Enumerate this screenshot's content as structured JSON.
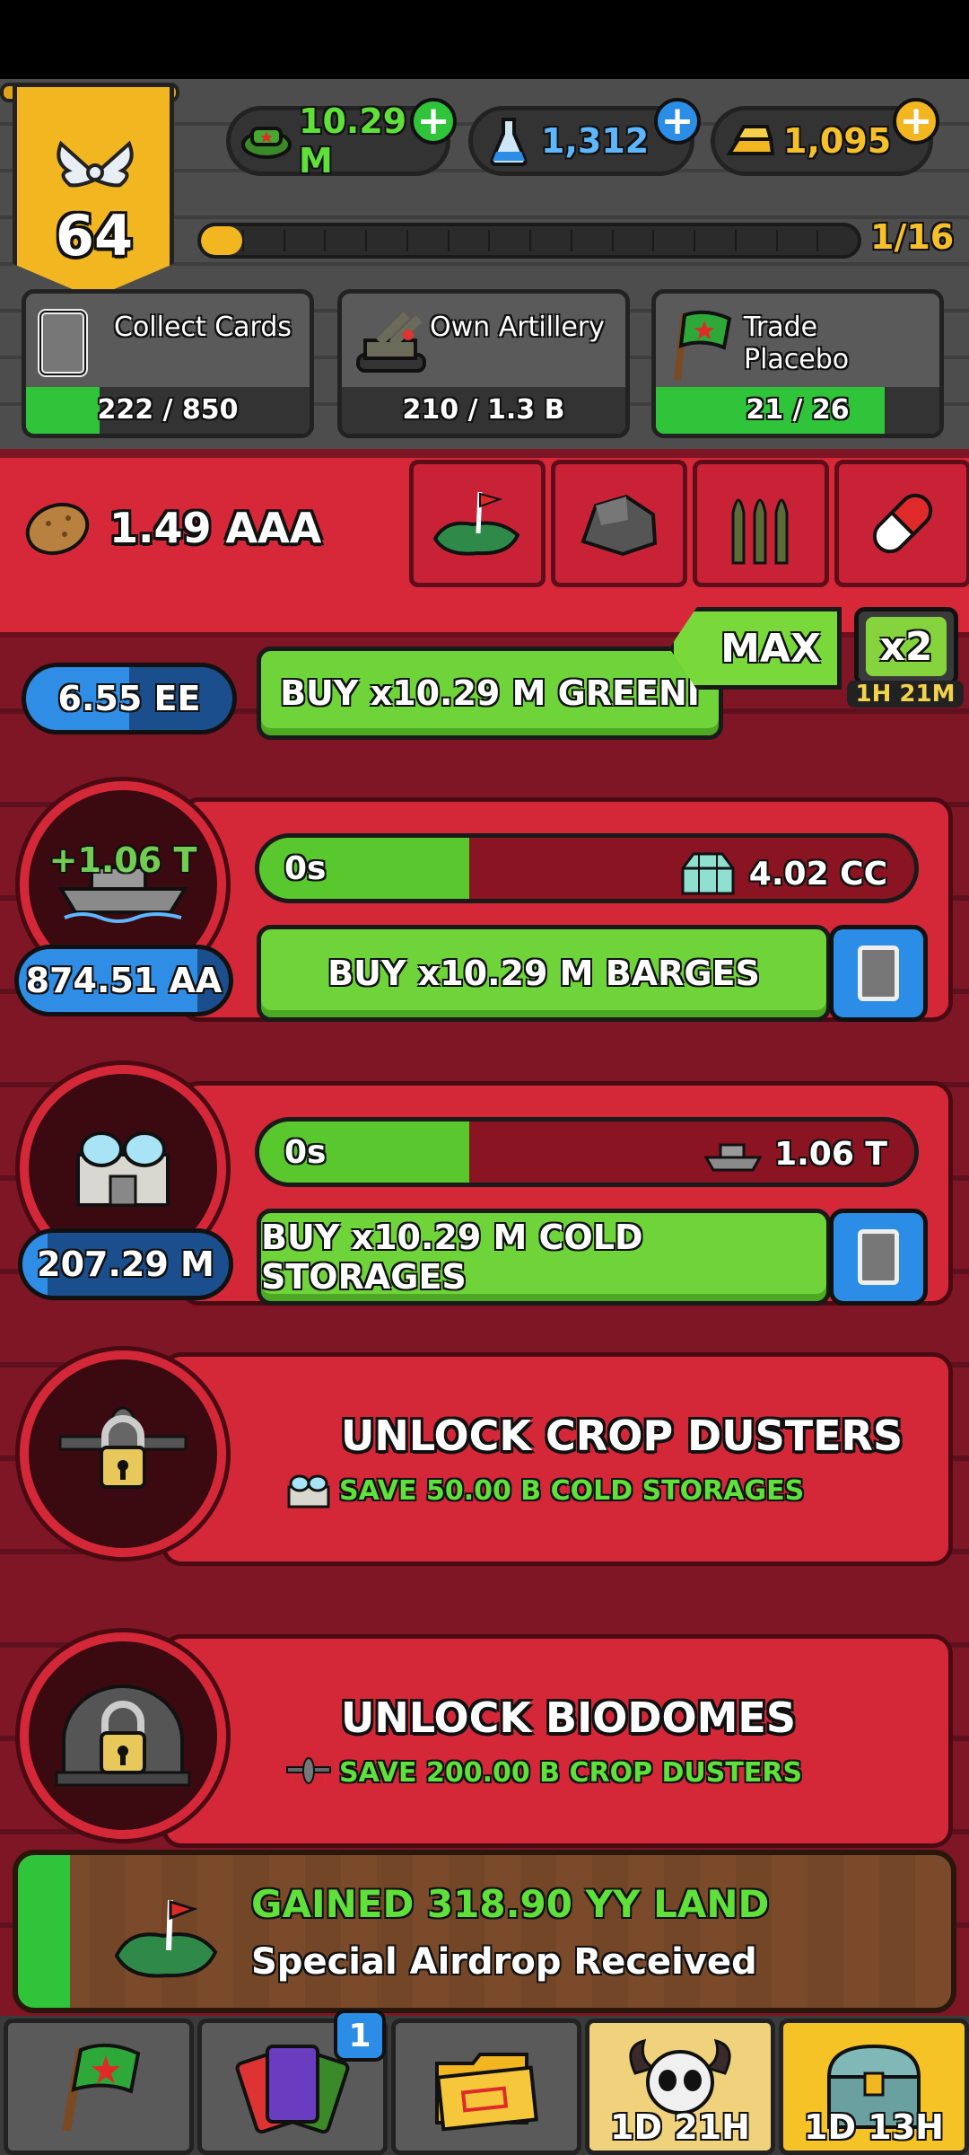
{
  "header": {
    "level": "64",
    "resources": [
      {
        "name": "money",
        "icon": "army-cap-icon",
        "value": "10.29 M",
        "color": "#2fc43a"
      },
      {
        "name": "science",
        "icon": "flask-icon",
        "value": "1,312",
        "color": "#2b8de6"
      },
      {
        "name": "gold",
        "icon": "gold-bars-icon",
        "value": "1,095",
        "color": "#f2b620"
      }
    ],
    "xp": {
      "text": "1/16",
      "progress": 0.0625
    }
  },
  "missions": [
    {
      "label": "Collect Cards",
      "progress_text": "222 / 850",
      "progress": 0.261
    },
    {
      "label": "Own Artillery",
      "progress_text": "210 / 1.3 B",
      "progress": 0
    },
    {
      "label": "Trade Placebo",
      "progress_text": "21 / 26",
      "progress": 0.807
    }
  ],
  "resource_bar": {
    "value": "1.49 AAA",
    "icon": "potato-icon"
  },
  "category_tabs": [
    {
      "icon": "land-flag-icon"
    },
    {
      "icon": "ore-icon"
    },
    {
      "icon": "ammo-icon"
    },
    {
      "icon": "pill-icon"
    }
  ],
  "controls": {
    "max_label": "MAX",
    "boost_label": "x2",
    "boost_time": "1H 21M"
  },
  "producers": [
    {
      "name": "greenhouses",
      "count": "6.55 EE",
      "buy_label": "BUY x10.29 M GREENI",
      "count_fill": 0.5
    },
    {
      "name": "barges",
      "count": "874.51 AA",
      "floating_gain": "+1.06 T",
      "time": "0s",
      "progress": 0.32,
      "output": "4.02 CC",
      "buy_label": "BUY x10.29 M BARGES",
      "count_fill": 0.85
    },
    {
      "name": "cold-storages",
      "count": "207.29 M",
      "time": "0s",
      "progress": 0.32,
      "output": "1.06 T",
      "buy_label": "BUY x10.29 M COLD STORAGES",
      "count_fill": 0.12
    }
  ],
  "locked": [
    {
      "title": "UNLOCK CROP DUSTERS",
      "requirement": "SAVE 50.00 B COLD STORAGES"
    },
    {
      "title": "UNLOCK BIODOMES",
      "requirement": "SAVE 200.00 B CROP DUSTERS"
    }
  ],
  "toast": {
    "line1": "GAINED 318.90 YY LAND",
    "line2": "Special Airdrop Received"
  },
  "bottom_nav": {
    "cards_badge": "1",
    "event1_time": "1D 21H",
    "event2_time": "1D 13H"
  }
}
